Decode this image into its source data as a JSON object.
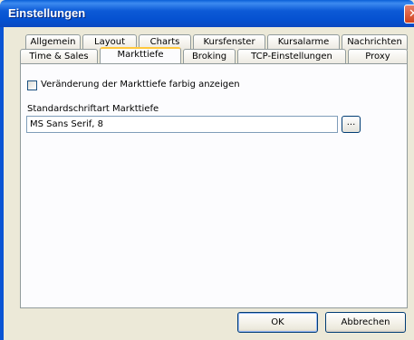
{
  "window": {
    "title": "Einstellungen",
    "close_glyph": "✕"
  },
  "tabs": {
    "row1": [
      {
        "label": "Allgemein"
      },
      {
        "label": "Layout"
      },
      {
        "label": "Charts"
      },
      {
        "label": "Kursfenster"
      },
      {
        "label": "Kursalarme"
      },
      {
        "label": "Nachrichten"
      }
    ],
    "row2": [
      {
        "label": "Time & Sales"
      },
      {
        "label": "Markttiefe",
        "active": true
      },
      {
        "label": "Broking"
      },
      {
        "label": "TCP-Einstellungen"
      },
      {
        "label": "Proxy"
      }
    ]
  },
  "markttiefe": {
    "color_checkbox_label": "Veränderung der Markttiefe farbig anzeigen",
    "color_checkbox_checked": false,
    "font_label": "Standardschriftart Markttiefe",
    "font_value": "MS Sans Serif, 8",
    "browse_label": "..."
  },
  "buttons": {
    "ok": "OK",
    "cancel": "Abbrechen"
  }
}
